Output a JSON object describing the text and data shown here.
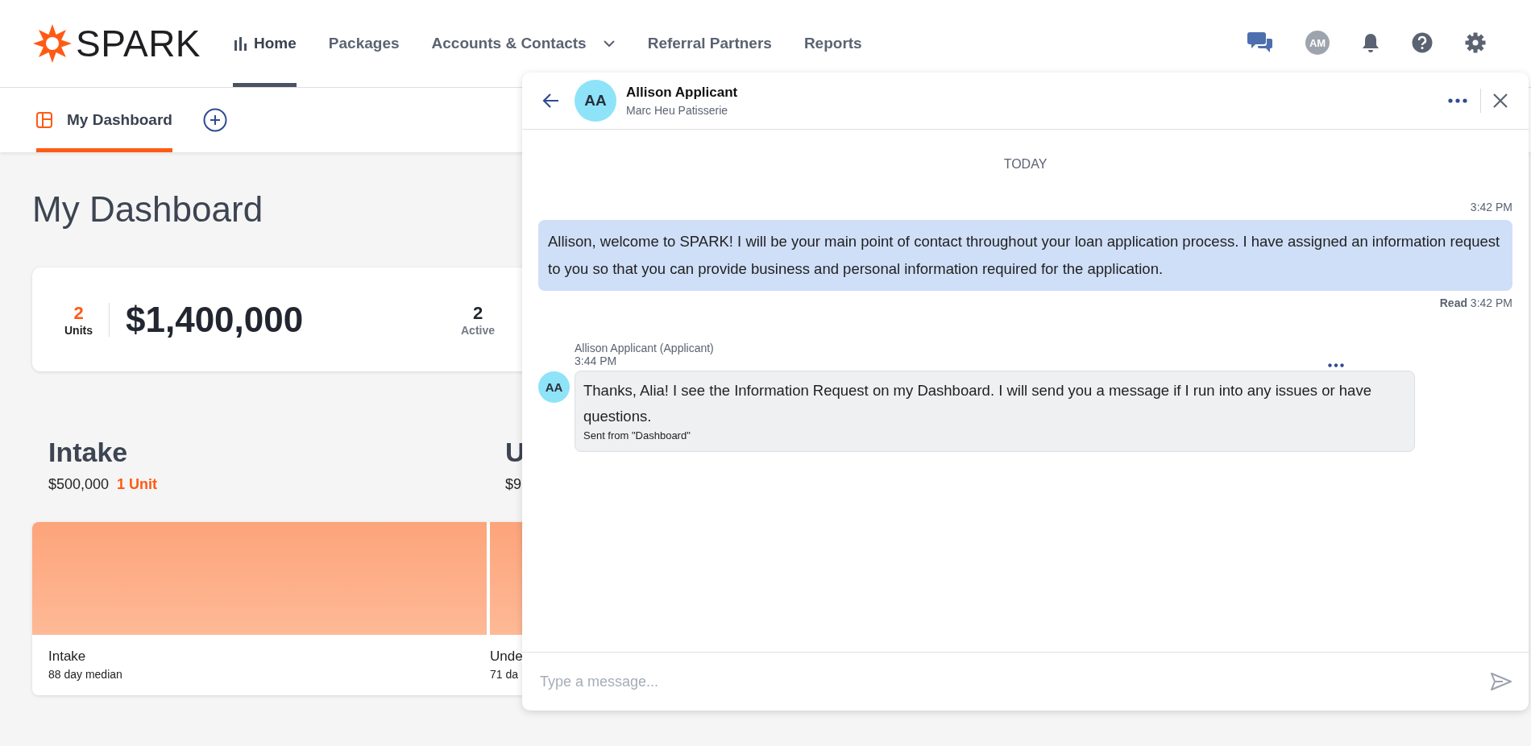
{
  "header": {
    "logo_text": "SPARK",
    "nav": [
      {
        "label": "Home",
        "kind": "icon",
        "selected": true
      },
      {
        "label": "Packages",
        "kind": "plain",
        "selected": false
      },
      {
        "label": "Accounts & Contacts",
        "kind": "dropdown",
        "selected": false
      },
      {
        "label": "Referral Partners",
        "kind": "plain",
        "selected": false
      },
      {
        "label": "Reports",
        "kind": "plain",
        "selected": false
      }
    ],
    "user_initials": "AM"
  },
  "tabs": [
    {
      "label": "My Dashboard",
      "selected": true
    }
  ],
  "page_title": "My Dashboard",
  "summary": {
    "units_count": "2",
    "units_label": "Units",
    "total": "$1,400,000",
    "stats": [
      {
        "value": "2",
        "label": "Active"
      }
    ]
  },
  "stages": [
    {
      "title": "Intake",
      "amount": "$500,000",
      "units": "1 Unit",
      "label": "Intake",
      "median": "88 day median"
    },
    {
      "title": "U",
      "amount": "$9",
      "label": "Unde",
      "median": "71 da"
    }
  ],
  "chat": {
    "contact": {
      "initials": "AA",
      "name": "Allison Applicant",
      "company": "Marc Heu Patisserie"
    },
    "date_divider": "TODAY",
    "messages": [
      {
        "kind": "outgoing",
        "time": "3:42 PM",
        "text": "Allison, welcome to SPARK! I will be your main point of contact throughout your loan application process. I have assigned an information request to you so that you can provide business and personal information required for the application.",
        "receipt": "**Read** 3:42 PM"
      },
      {
        "kind": "incoming",
        "sender": "Allison Applicant (Applicant)",
        "time": "3:44 PM",
        "initials": "AA",
        "text": "Thanks, Alia! I see the Information Request on my Dashboard. I will send you a message if I run into any issues or have questions.",
        "source": "Sent from \"Dashboard\""
      }
    ],
    "composer": {
      "placeholder": "Type a message..."
    }
  }
}
